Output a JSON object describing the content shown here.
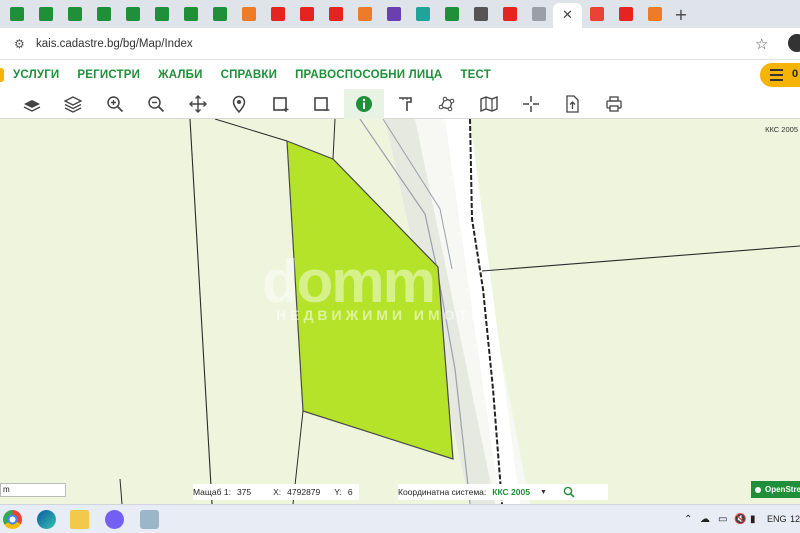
{
  "browser": {
    "tabs_count": 24,
    "active_tab_close_glyph": "✕",
    "new_tab_glyph": "+",
    "url": "kais.cadastre.bg/bg/Map/Index"
  },
  "site_nav": {
    "items": [
      "УСЛУГИ",
      "РЕГИСТРИ",
      "ЖАЛБИ",
      "СПРАВКИ",
      "ПРАВОСПОСОБНИ ЛИЦА",
      "ТЕСТ"
    ],
    "menu_label": "0"
  },
  "toolbar": {
    "tools": [
      "base-layer-icon",
      "layers-icon",
      "zoom-in-icon",
      "zoom-out-icon",
      "pan-icon",
      "locate-pin-icon",
      "select-rect-icon",
      "select-rect-minus-icon",
      "info-icon",
      "measure-icon",
      "polygon-icon",
      "map-icon",
      "crosshair-icon",
      "export-icon",
      "print-icon"
    ],
    "active_tool": "info-icon"
  },
  "map": {
    "crs_corner": "ККС 2005",
    "watermark": "domm",
    "watermark_sub": "НЕДВИЖИМИ ИМОТИ",
    "parcel_color": "#b5e32a",
    "background_color": "#eff4dd"
  },
  "status": {
    "scale_input_value": "m",
    "scale_label": "Мащаб 1:",
    "scale_value": "375",
    "x_label": "X:",
    "x_value": "4792879",
    "y_label": "Y:",
    "y_value": "6",
    "crs_label": "Координатна система:",
    "crs_value": "ККС 2005",
    "osm_label": "OpenStre"
  },
  "taskbar": {
    "language": "ENG",
    "clock": "12"
  }
}
